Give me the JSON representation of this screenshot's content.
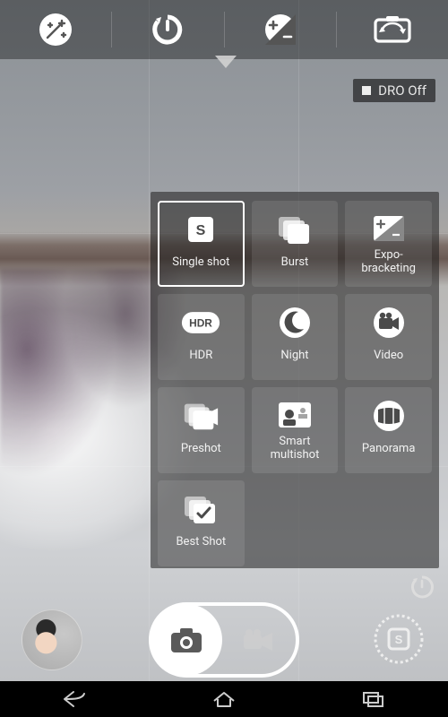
{
  "dro": {
    "label": "DRO Off"
  },
  "topbar": {
    "effects": "effects-icon",
    "timer": "timer-icon",
    "exposure": "exposure-icon",
    "switch": "switch-camera-icon"
  },
  "modes": [
    {
      "id": "single-shot",
      "label": "Single shot",
      "selected": true
    },
    {
      "id": "burst",
      "label": "Burst",
      "selected": false
    },
    {
      "id": "expo-bracketing",
      "label": "Expo-\nbracketing",
      "selected": false
    },
    {
      "id": "hdr",
      "label": "HDR",
      "selected": false
    },
    {
      "id": "night",
      "label": "Night",
      "selected": false
    },
    {
      "id": "video",
      "label": "Video",
      "selected": false
    },
    {
      "id": "preshot",
      "label": "Preshot",
      "selected": false
    },
    {
      "id": "smart-multishot",
      "label": "Smart\nmultishot",
      "selected": false
    },
    {
      "id": "panorama",
      "label": "Panorama",
      "selected": false
    },
    {
      "id": "best-shot",
      "label": "Best Shot",
      "selected": false
    }
  ],
  "bottom": {
    "timer_icon": "timer-small-icon",
    "thumbnail": "gallery-thumbnail",
    "shutter_photo": "photo-shutter",
    "shutter_video": "video-shutter",
    "mode_stamp": "S"
  },
  "navbar": {
    "back": "back",
    "home": "home",
    "recents": "recents"
  }
}
